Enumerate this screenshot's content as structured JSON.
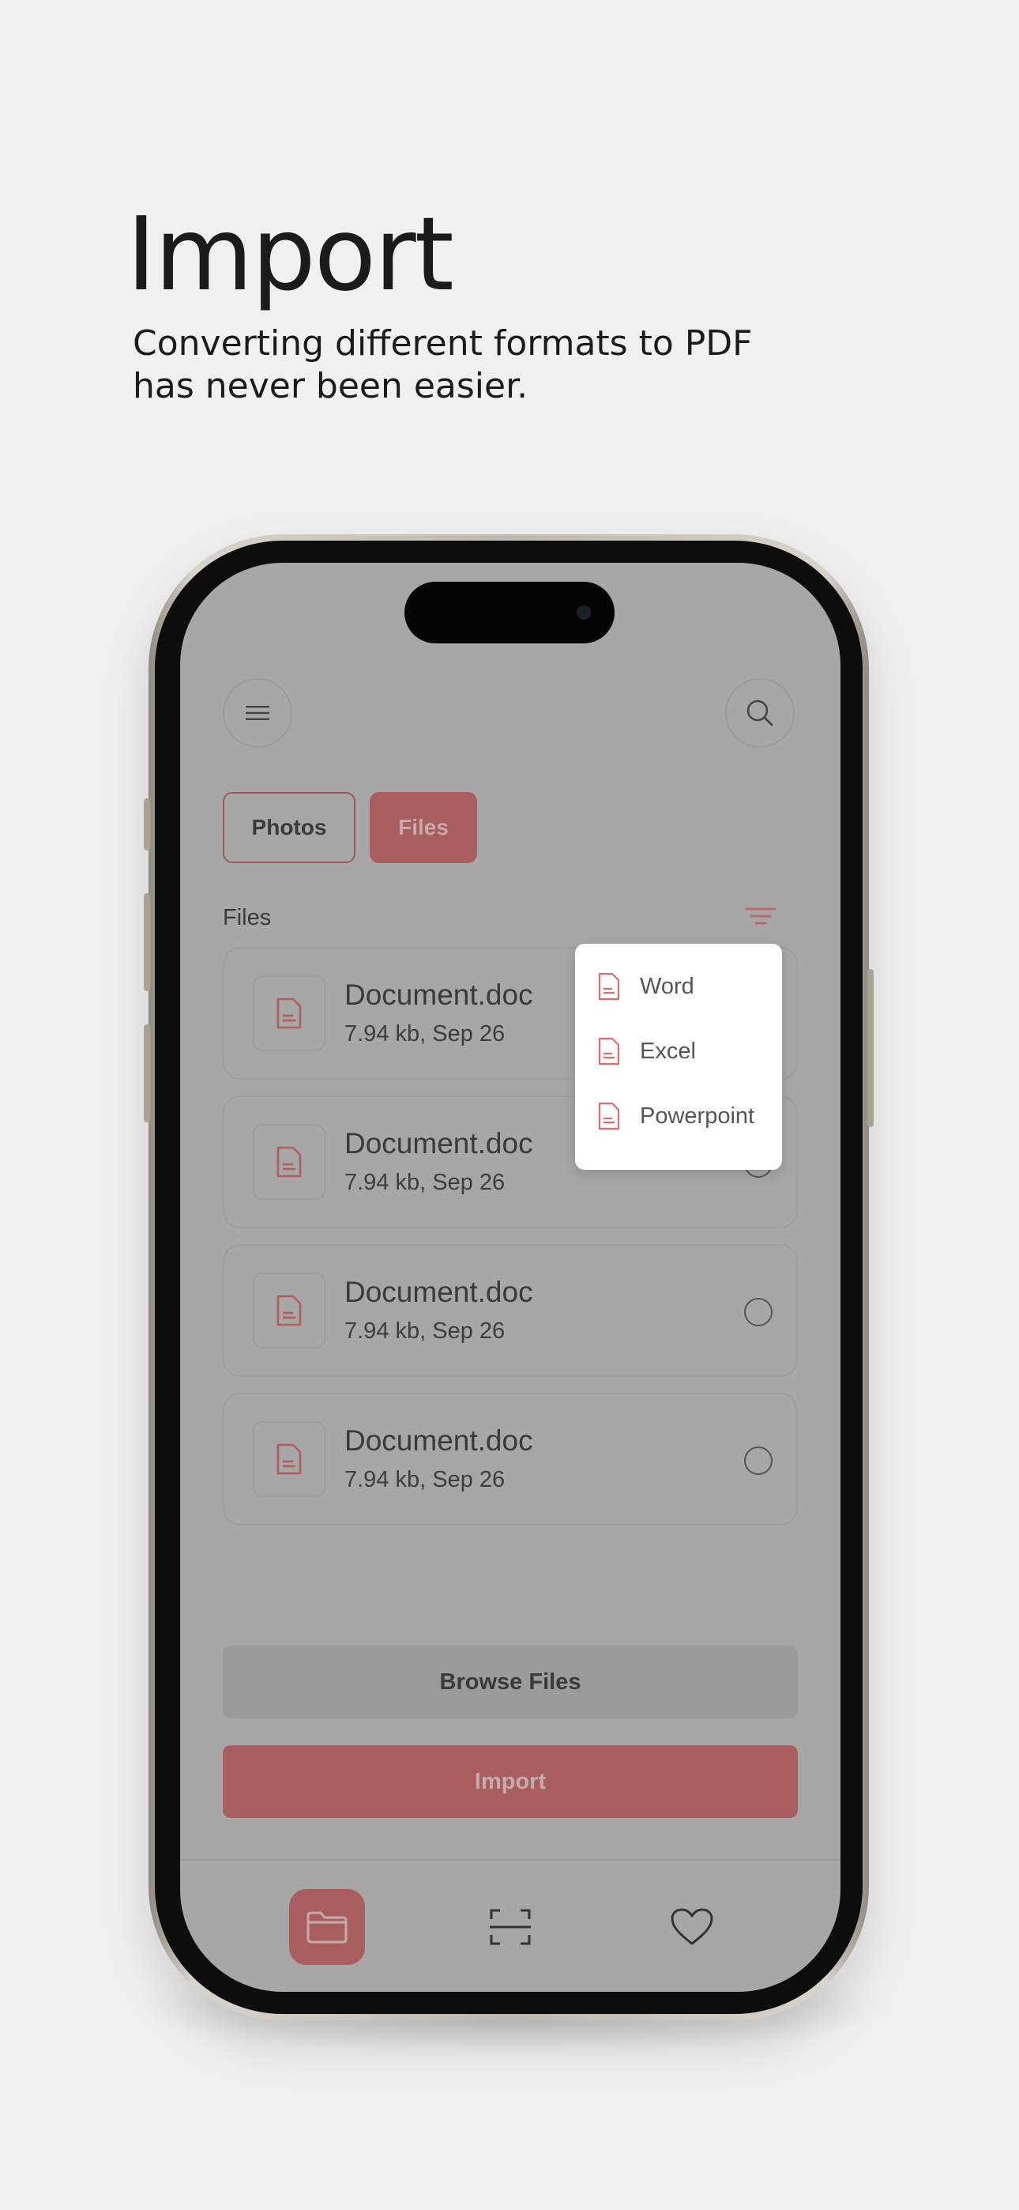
{
  "promo": {
    "title": "Import",
    "subtitle_line1": "Converting different formats to PDF",
    "subtitle_line2": "has never been easier."
  },
  "header": {
    "menu_icon": "hamburger-menu-icon",
    "search_icon": "search-icon"
  },
  "tabs": [
    {
      "label": "Photos",
      "active": false
    },
    {
      "label": "Files",
      "active": true
    }
  ],
  "files_section": {
    "label": "Files",
    "filter_icon": "filter-icon"
  },
  "files": [
    {
      "name": "Document.doc",
      "meta": "7.94 kb, Sep 26"
    },
    {
      "name": "Document.doc",
      "meta": "7.94 kb, Sep 26"
    },
    {
      "name": "Document.doc",
      "meta": "7.94 kb, Sep 26"
    },
    {
      "name": "Document.doc",
      "meta": "7.94 kb, Sep 26"
    }
  ],
  "filter_menu": {
    "items": [
      {
        "label": "Word",
        "icon": "document-icon"
      },
      {
        "label": "Excel",
        "icon": "document-icon"
      },
      {
        "label": "Powerpoint",
        "icon": "document-icon"
      }
    ]
  },
  "actions": {
    "browse_label": "Browse Files",
    "import_label": "Import"
  },
  "bottom_nav": {
    "items": [
      {
        "name": "files",
        "icon": "folder-icon",
        "active": true
      },
      {
        "name": "scan",
        "icon": "scan-icon",
        "active": false
      },
      {
        "name": "favorites",
        "icon": "heart-icon",
        "active": false
      }
    ]
  },
  "colors": {
    "accent": "#e06b6b",
    "accent_dimmed": "#a85e5e",
    "overlay_gray": "#a7a7a7",
    "page_background": "#f0f0f0"
  }
}
